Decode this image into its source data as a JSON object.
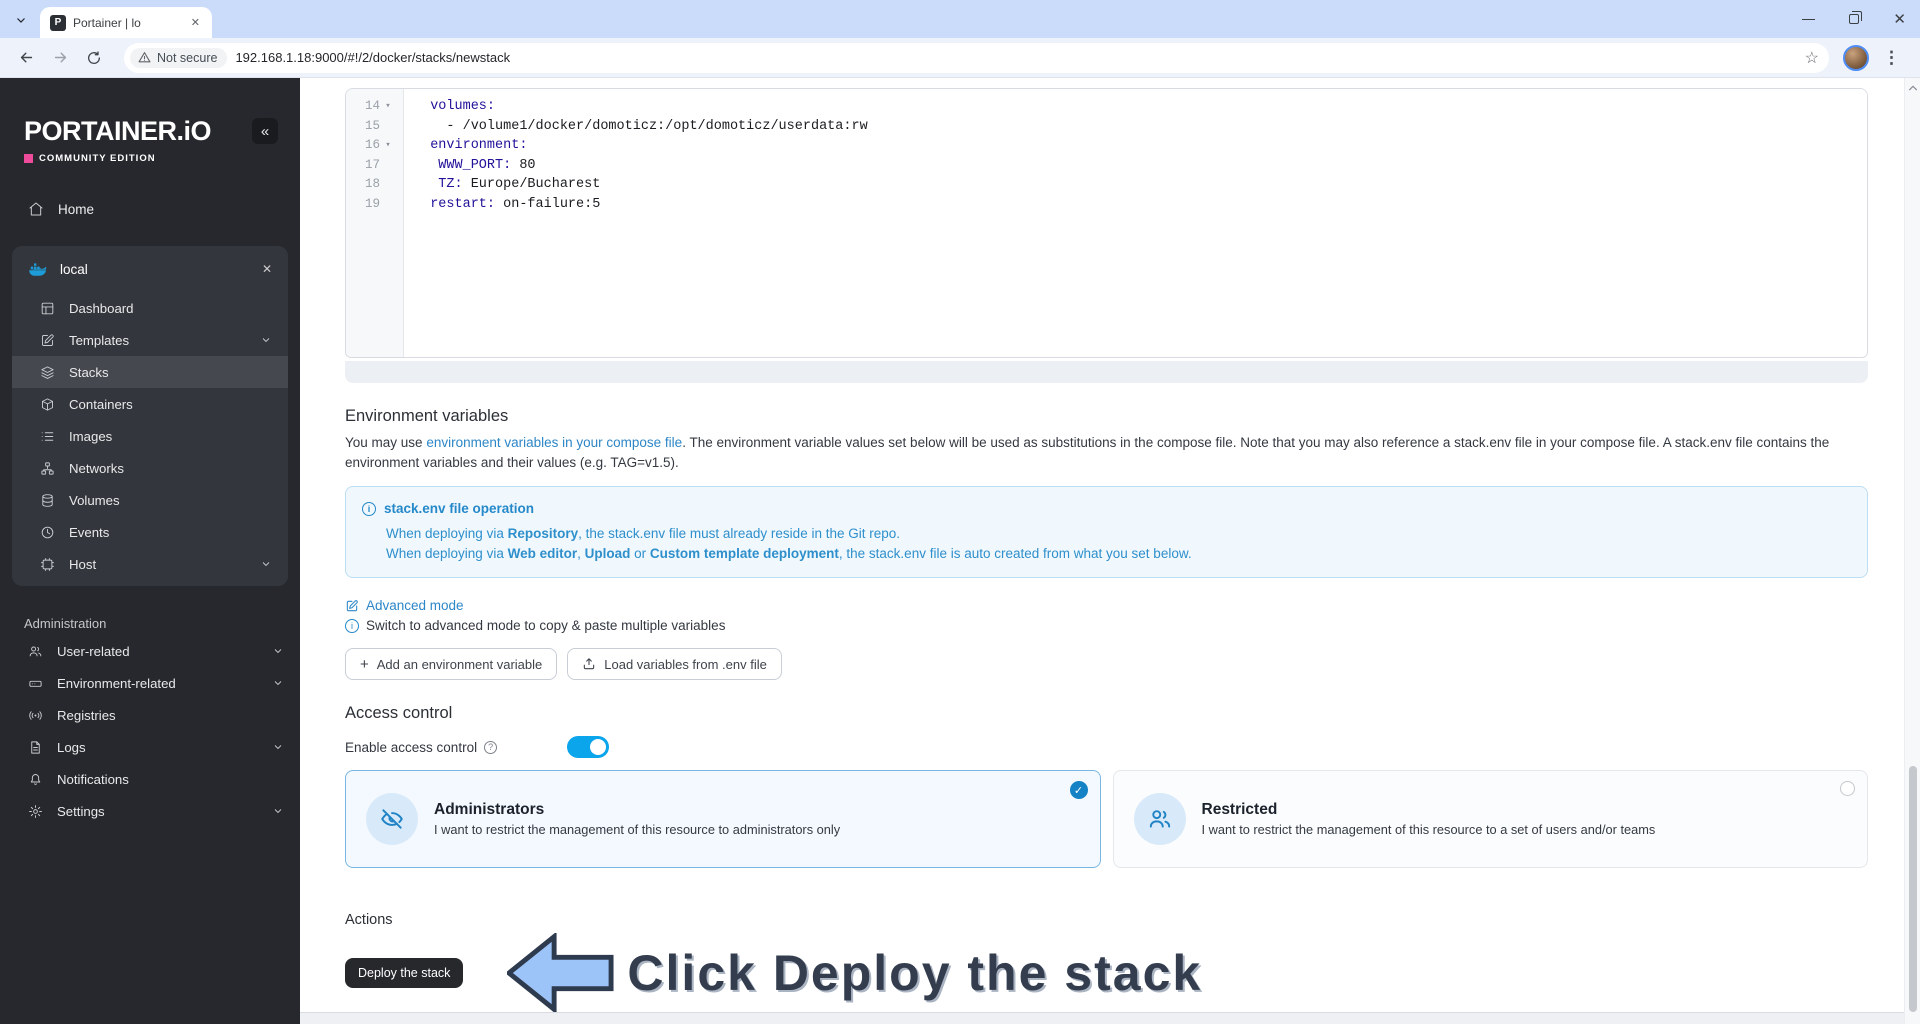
{
  "browser": {
    "tab_title": "Portainer | lo",
    "security_label": "Not secure",
    "url": "192.168.1.18:9000/#!/2/docker/stacks/newstack"
  },
  "icons": {
    "favicon_letter": "P",
    "tab_close": "✕",
    "window_close": "✕",
    "kebab": "⋮",
    "star": "☆",
    "collapse": "«",
    "env_close": "✕",
    "plus": "+",
    "check": "✓",
    "fold": "▾",
    "info_char": "i",
    "help_char": "?"
  },
  "sidebar": {
    "logo": "PORTAINER.iO",
    "edition": "COMMUNITY EDITION",
    "home_label": "Home",
    "env_name": "local",
    "env_items": [
      {
        "label": "Dashboard"
      },
      {
        "label": "Templates"
      },
      {
        "label": "Stacks"
      },
      {
        "label": "Containers"
      },
      {
        "label": "Images"
      },
      {
        "label": "Networks"
      },
      {
        "label": "Volumes"
      },
      {
        "label": "Events"
      },
      {
        "label": "Host"
      }
    ],
    "admin_label": "Administration",
    "admin_items": [
      {
        "label": "User-related"
      },
      {
        "label": "Environment-related"
      },
      {
        "label": "Registries"
      },
      {
        "label": "Logs"
      },
      {
        "label": "Notifications"
      },
      {
        "label": "Settings"
      }
    ]
  },
  "editor": {
    "lines": [
      {
        "num": "14",
        "fold": "▾",
        "key": "  volumes:",
        "value": ""
      },
      {
        "num": "15",
        "fold": "",
        "key": "",
        "value": "    - /volume1/docker/domoticz:/opt/domoticz/userdata:rw"
      },
      {
        "num": "16",
        "fold": "▾",
        "key": "  environment:",
        "value": ""
      },
      {
        "num": "17",
        "fold": "",
        "key": "   WWW_PORT:",
        "value": " 80"
      },
      {
        "num": "18",
        "fold": "",
        "key": "   TZ:",
        "value": " Europe/Bucharest"
      },
      {
        "num": "19",
        "fold": "",
        "key": "  restart:",
        "value": " on-failure:5"
      }
    ]
  },
  "env_section": {
    "heading": "Environment variables",
    "desc_pre": "You may use ",
    "desc_link": "environment variables in your compose file",
    "desc_post": ". The environment variable values set below will be used as substitutions in the compose file. Note that you may also reference a stack.env file in your compose file. A stack.env file contains the environment variables and their values (e.g. TAG=v1.5).",
    "info_title": "stack.env file operation",
    "info_line1": [
      {
        "text": "When deploying via "
      },
      {
        "text": "Repository"
      },
      {
        "text": ", the stack.env file must already reside in the Git repo."
      }
    ],
    "info_line2": [
      {
        "text": "When deploying via "
      },
      {
        "text": "Web editor"
      },
      {
        "text": ", "
      },
      {
        "text": "Upload"
      },
      {
        "text": " or "
      },
      {
        "text": "Custom template deployment"
      },
      {
        "text": ", the stack.env file is auto created from what you set below."
      }
    ],
    "advanced_mode": "Advanced mode",
    "advanced_hint": "Switch to advanced mode to copy & paste multiple variables",
    "add_var_btn": "Add an environment variable",
    "load_env_btn": "Load variables from .env file"
  },
  "access_control": {
    "heading": "Access control",
    "toggle_label": "Enable access control",
    "toggle_on": true,
    "options": [
      {
        "title": "Administrators",
        "desc": "I want to restrict the management of this resource to administrators only",
        "selected": true
      },
      {
        "title": "Restricted",
        "desc": "I want to restrict the management of this resource to a set of users and/or teams",
        "selected": false
      }
    ]
  },
  "actions": {
    "heading": "Actions",
    "deploy_btn": "Deploy the stack",
    "annotation": "Click Deploy the stack"
  },
  "colors": {
    "accent_blue": "#0ba5ec",
    "link_blue": "#2d86c7",
    "info_blue": "#2e8fcb",
    "docker_blue": "#1d9cd8",
    "code_key": "#221199",
    "annotation_arrow_fill": "#9dc4f8",
    "annotation_text": "#333d4e",
    "deploy_btn_bg": "#26282c",
    "edition_pink": "#ee4c9b",
    "selected_card_bg": "#f3f9fe"
  }
}
